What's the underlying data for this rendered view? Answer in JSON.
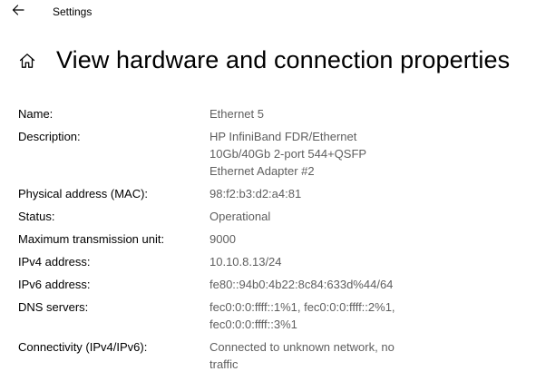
{
  "window": {
    "title": "Settings"
  },
  "icons": {
    "back": "back-arrow-icon",
    "home": "home-icon"
  },
  "page": {
    "title": "View hardware and connection properties"
  },
  "properties": {
    "name": {
      "label": "Name:",
      "value": "Ethernet 5"
    },
    "description": {
      "label": "Description:",
      "lines": [
        "HP InfiniBand FDR/Ethernet",
        "10Gb/40Gb 2-port 544+QSFP",
        "Ethernet Adapter #2"
      ]
    },
    "mac": {
      "label": "Physical address (MAC):",
      "value": "98:f2:b3:d2:a4:81"
    },
    "status": {
      "label": "Status:",
      "value": "Operational"
    },
    "mtu": {
      "label": "Maximum transmission unit:",
      "value": "9000"
    },
    "ipv4": {
      "label": "IPv4 address:",
      "value": "10.10.8.13/24"
    },
    "ipv6": {
      "label": "IPv6 address:",
      "value": "fe80::94b0:4b22:8c84:633d%44/64"
    },
    "dns": {
      "label": "DNS servers:",
      "lines": [
        "fec0:0:0:ffff::1%1, fec0:0:0:ffff::2%1,",
        "fec0:0:0:ffff::3%1"
      ]
    },
    "connectivity": {
      "label": "Connectivity (IPv4/IPv6):",
      "lines": [
        "Connected to unknown network, no",
        "traffic"
      ]
    }
  },
  "colors": {
    "background": "#ffffff",
    "label_text": "#000000",
    "value_text": "#5f5f5f"
  }
}
